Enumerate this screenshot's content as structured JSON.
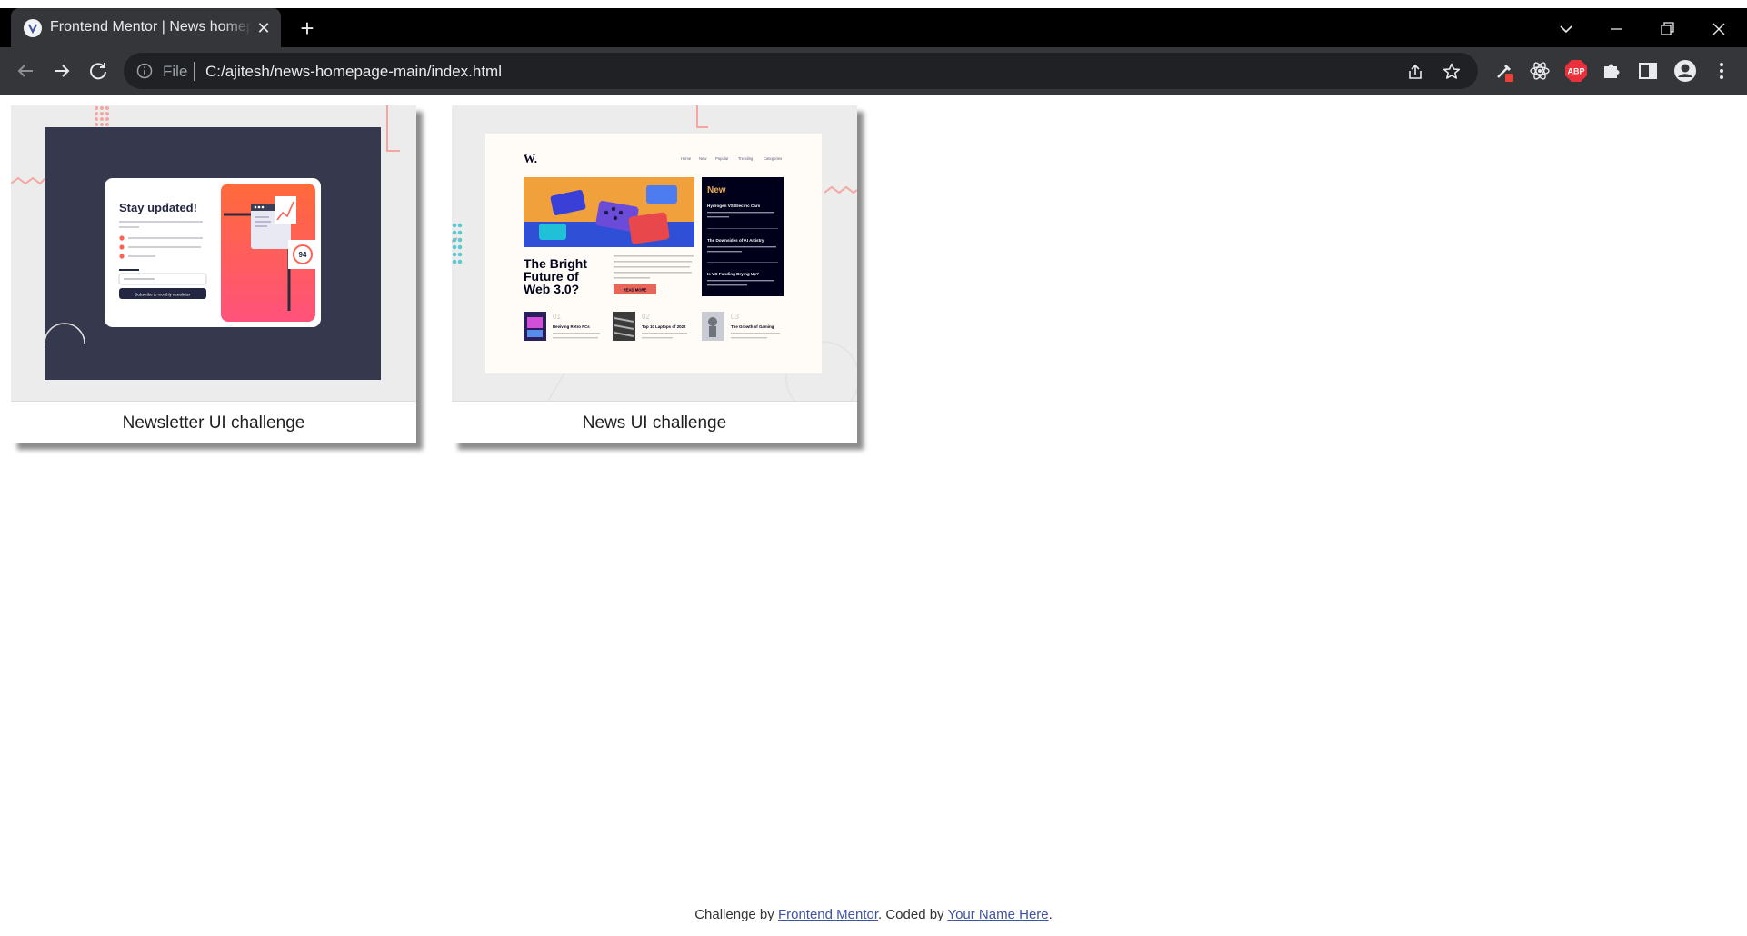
{
  "browser": {
    "tab_title": "Frontend Mentor | News homepage",
    "url_scheme": "File",
    "url": "C:/ajitesh/news-homepage-main/index.html",
    "extensions": [
      "eyedropper-icon",
      "react-devtools-icon",
      "adblock-plus-icon",
      "puzzle-extensions-icon",
      "side-panel-icon",
      "profile-icon",
      "menu-kebab-icon"
    ],
    "abp_label": "ABP"
  },
  "cards": [
    {
      "caption": "Newsletter UI challenge",
      "preview": {
        "heading": "Stay updated!",
        "score": "94",
        "button": "Subscribe to monthly newsletter"
      }
    },
    {
      "caption": "News UI challenge",
      "preview": {
        "logo": "W.",
        "nav": [
          "Home",
          "New",
          "Popular",
          "Trending",
          "Categories"
        ],
        "headline": "The Bright Future of Web 3.0?",
        "read_more": "READ MORE",
        "new_label": "New",
        "new_items": [
          "Hydrogen VS Electric Cars",
          "The Downsides of AI Artistry",
          "Is VC Funding Drying Up?"
        ],
        "bottom_items": [
          {
            "num": "01",
            "title": "Reviving Retro PCs"
          },
          {
            "num": "02",
            "title": "Top 10 Laptops of 2022"
          },
          {
            "num": "03",
            "title": "The Growth of Gaming"
          }
        ]
      }
    }
  ],
  "footer": {
    "prefix": "Challenge by ",
    "link1": "Frontend Mentor",
    "middle": ". Coded by ",
    "link2": "Your Name Here",
    "suffix": "."
  },
  "colors": {
    "chrome_dark": "#35363a",
    "tabbar": "#000000",
    "newsletter_bg": "#36384e",
    "accent_coral": "#ff6155",
    "news_dark": "#00001a",
    "news_orange": "#e9ab53",
    "link": "#3e52a3"
  }
}
